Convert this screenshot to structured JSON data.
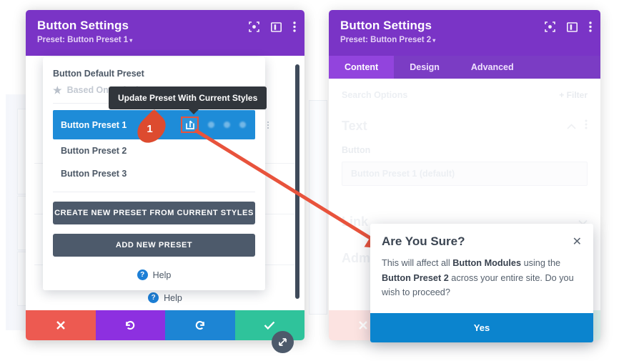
{
  "left_modal": {
    "title": "Button Settings",
    "preset_label": "Preset: Button Preset 1",
    "caret": "▾",
    "header_icons": [
      "focus-target-icon",
      "layout-columns-icon",
      "kebab-menu-icon"
    ],
    "dropdown": {
      "default_preset_title": "Button Default Preset",
      "based_on_label": "Based On Default Preset",
      "presets": [
        {
          "label": "Button Preset 1",
          "active": true
        },
        {
          "label": "Button Preset 2",
          "active": false
        },
        {
          "label": "Button Preset 3",
          "active": false
        }
      ],
      "create_button": "CREATE NEW PRESET FROM CURRENT STYLES",
      "add_button": "ADD NEW PRESET",
      "help_label": "Help",
      "help_badge": "?"
    },
    "lower_help_label": "Help",
    "tooltip": "Update Preset With Current Styles",
    "step_number": "1",
    "actions": [
      {
        "name": "cancel",
        "glyph": "✖",
        "color": "#ed5a51"
      },
      {
        "name": "undo",
        "glyph": "↺",
        "color": "#8d30e0"
      },
      {
        "name": "redo",
        "glyph": "↻",
        "color": "#1d85d4"
      },
      {
        "name": "save",
        "glyph": "✔",
        "color": "#2fc39b"
      }
    ]
  },
  "right_modal": {
    "title": "Button Settings",
    "preset_label": "Preset: Button Preset 2",
    "caret": "▾",
    "tabs": [
      {
        "label": "Content",
        "active": true
      },
      {
        "label": "Design",
        "active": false
      },
      {
        "label": "Advanced",
        "active": false
      }
    ],
    "search_placeholder": "Search Options",
    "filter_label": "Filter",
    "filter_plus": "+",
    "section_text_title": "Text",
    "section_link_title": "Link",
    "section_admin_title": "Admin Label",
    "field_label": "Button",
    "field_value": "Button Preset 1 (default)"
  },
  "confirm_dialog": {
    "title": "Are You Sure?",
    "close_glyph": "✕",
    "body_part1": "This will affect all ",
    "body_strong1": "Button Modules",
    "body_part2": " using the ",
    "body_strong2": "Button Preset 2",
    "body_part3": " across your entire site. Do you wish to proceed?",
    "yes_label": "Yes"
  },
  "colors": {
    "purple_header": "#7a34c6",
    "tabbar_purple": "#7b3cc4",
    "active_tab_purple": "#9244dd",
    "active_preset_blue": "#1e8cd8",
    "dark_button": "#4d5a6b",
    "accent_red": "#e8533c",
    "primary_blue": "#0b84ce",
    "tooltip_dark": "#31363c"
  }
}
